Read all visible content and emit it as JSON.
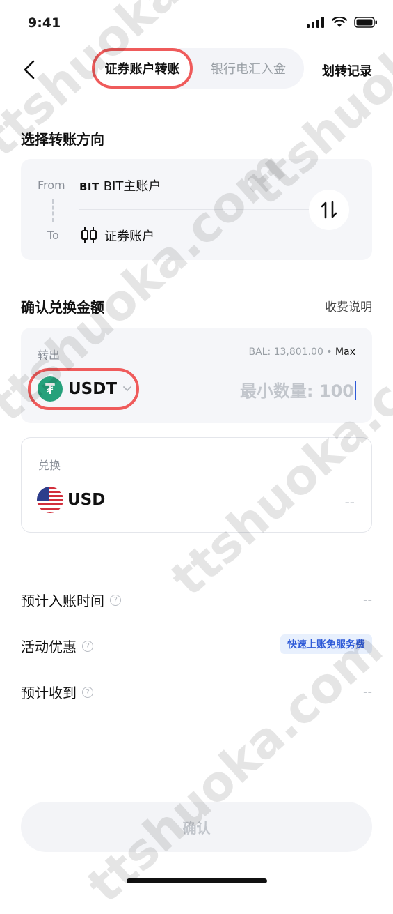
{
  "status_bar": {
    "time": "9:41"
  },
  "header": {
    "tabs": [
      {
        "label": "证券账户转账",
        "active": true
      },
      {
        "label": "银行电汇入金",
        "active": false
      }
    ],
    "records_label": "划转记录"
  },
  "direction": {
    "title": "选择转账方向",
    "from_label": "From",
    "from_logo": "BIT",
    "from_value": "BIT主账户",
    "to_label": "To",
    "to_value": "证券账户"
  },
  "amount": {
    "title": "确认兑换金额",
    "fee_link": "收费说明",
    "out_label": "转出",
    "balance": "BAL: 13,801.00",
    "balance_sep": "•",
    "max_label": "Max",
    "coin": "USDT",
    "placeholder": "最小数量: 100",
    "exchange_label": "兑换",
    "exchange_coin": "USD",
    "exchange_value": "--"
  },
  "info": {
    "arrival_time_label": "预计入账时间",
    "arrival_time_value": "--",
    "promo_label": "活动优惠",
    "promo_badge": "快速上账免服务费",
    "receive_label": "预计收到",
    "receive_value": "--"
  },
  "confirm_label": "确认",
  "watermark": "ttshuoka.com",
  "colors": {
    "highlight": "#ef5b5b",
    "accent": "#2f5bd8",
    "tether": "#26a17b"
  }
}
